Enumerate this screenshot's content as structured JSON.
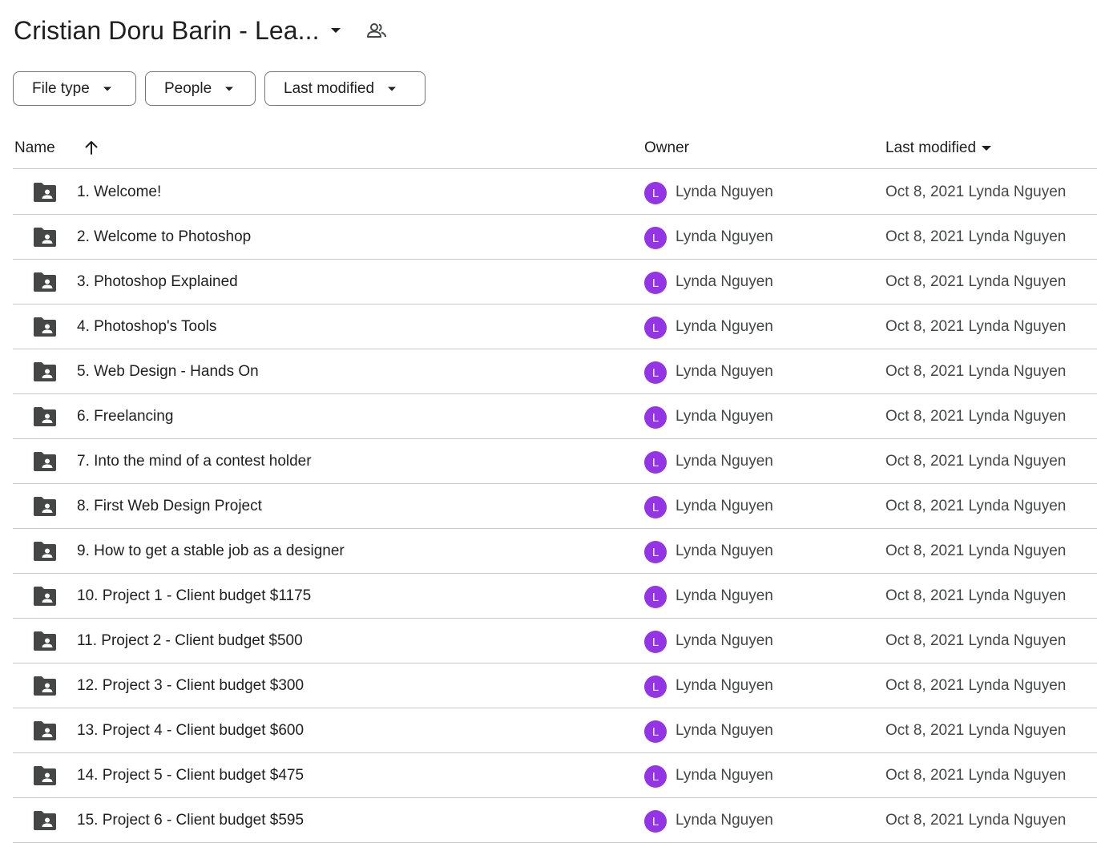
{
  "header": {
    "title": "Cristian Doru Barin - Lea...",
    "title_caret_icon": "arrow-drop-down-icon",
    "shared_icon": "people-outline-icon"
  },
  "filters": [
    {
      "label": "File type",
      "icon": "arrow-drop-down-icon"
    },
    {
      "label": "People",
      "icon": "arrow-drop-down-icon"
    },
    {
      "label": "Last modified",
      "icon": "arrow-drop-down-icon"
    }
  ],
  "table": {
    "columns": {
      "name": "Name",
      "owner": "Owner",
      "last_modified": "Last modified"
    },
    "sort_icon": "arrow-upward-icon",
    "rows": [
      {
        "name": "1. Welcome!",
        "owner": "Lynda Nguyen",
        "avatar": "L",
        "modified": "Oct 8, 2021 Lynda Nguyen"
      },
      {
        "name": "2. Welcome to Photoshop",
        "owner": "Lynda Nguyen",
        "avatar": "L",
        "modified": "Oct 8, 2021 Lynda Nguyen"
      },
      {
        "name": "3. Photoshop Explained",
        "owner": "Lynda Nguyen",
        "avatar": "L",
        "modified": "Oct 8, 2021 Lynda Nguyen"
      },
      {
        "name": "4. Photoshop's Tools",
        "owner": "Lynda Nguyen",
        "avatar": "L",
        "modified": "Oct 8, 2021 Lynda Nguyen"
      },
      {
        "name": "5. Web Design - Hands On",
        "owner": "Lynda Nguyen",
        "avatar": "L",
        "modified": "Oct 8, 2021 Lynda Nguyen"
      },
      {
        "name": "6. Freelancing",
        "owner": "Lynda Nguyen",
        "avatar": "L",
        "modified": "Oct 8, 2021 Lynda Nguyen"
      },
      {
        "name": "7. Into the mind of a contest holder",
        "owner": "Lynda Nguyen",
        "avatar": "L",
        "modified": "Oct 8, 2021 Lynda Nguyen"
      },
      {
        "name": "8. First Web Design Project",
        "owner": "Lynda Nguyen",
        "avatar": "L",
        "modified": "Oct 8, 2021 Lynda Nguyen"
      },
      {
        "name": "9. How to get a stable job as a designer",
        "owner": "Lynda Nguyen",
        "avatar": "L",
        "modified": "Oct 8, 2021 Lynda Nguyen"
      },
      {
        "name": "10. Project 1 - Client budget $1175",
        "owner": "Lynda Nguyen",
        "avatar": "L",
        "modified": "Oct 8, 2021 Lynda Nguyen"
      },
      {
        "name": "11. Project 2 - Client budget $500",
        "owner": "Lynda Nguyen",
        "avatar": "L",
        "modified": "Oct 8, 2021 Lynda Nguyen"
      },
      {
        "name": "12. Project 3 - Client budget $300",
        "owner": "Lynda Nguyen",
        "avatar": "L",
        "modified": "Oct 8, 2021 Lynda Nguyen"
      },
      {
        "name": "13. Project 4 - Client budget $600",
        "owner": "Lynda Nguyen",
        "avatar": "L",
        "modified": "Oct 8, 2021 Lynda Nguyen"
      },
      {
        "name": "14. Project 5 - Client budget $475",
        "owner": "Lynda Nguyen",
        "avatar": "L",
        "modified": "Oct 8, 2021 Lynda Nguyen"
      },
      {
        "name": "15. Project 6 - Client budget $595",
        "owner": "Lynda Nguyen",
        "avatar": "L",
        "modified": "Oct 8, 2021 Lynda Nguyen"
      }
    ],
    "row_icon": "shared-folder-icon"
  },
  "colors": {
    "avatar": "#9334e6",
    "text": "#1f1f1f",
    "secondary_text": "#444746",
    "divider": "#c7c7c7",
    "chip_border": "#747775",
    "folder_icon": "#444746"
  }
}
